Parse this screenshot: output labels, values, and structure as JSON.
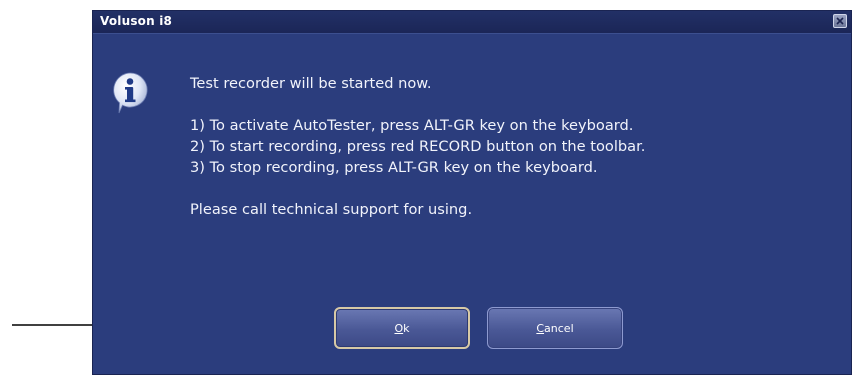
{
  "dialog": {
    "title": "Voluson i8",
    "message_heading": "Test recorder will be started now.",
    "steps": [
      "1) To activate AutoTester, press ALT-GR key on the keyboard.",
      "2) To start recording, press red RECORD button on the toolbar.",
      "3) To stop recording, press ALT-GR key on the keyboard."
    ],
    "footer_note": "Please call technical support for using.",
    "buttons": {
      "ok_accel": "O",
      "ok_rest": "k",
      "cancel_accel": "C",
      "cancel_rest": "ancel"
    },
    "icons": {
      "info": "info-icon",
      "close": "close-icon",
      "pointer": "arrow-right-icon"
    }
  }
}
